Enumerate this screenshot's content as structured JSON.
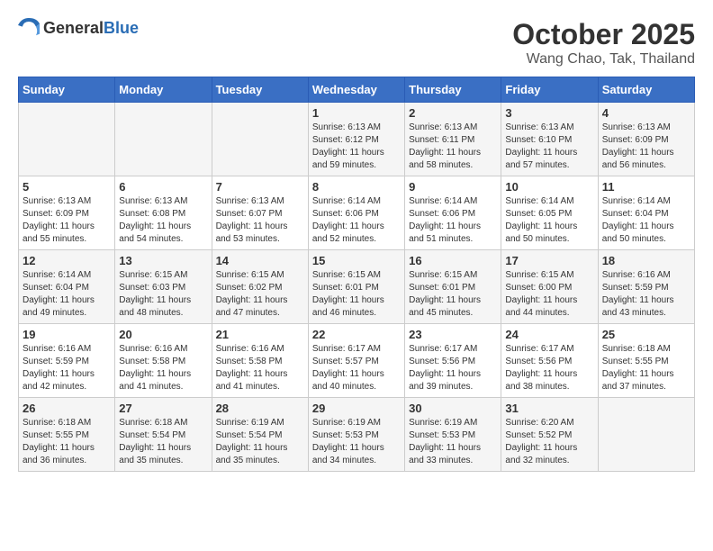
{
  "header": {
    "logo_general": "General",
    "logo_blue": "Blue",
    "month": "October 2025",
    "location": "Wang Chao, Tak, Thailand"
  },
  "calendar": {
    "weekdays": [
      "Sunday",
      "Monday",
      "Tuesday",
      "Wednesday",
      "Thursday",
      "Friday",
      "Saturday"
    ],
    "weeks": [
      [
        {
          "day": "",
          "sunrise": "",
          "sunset": "",
          "daylight": ""
        },
        {
          "day": "",
          "sunrise": "",
          "sunset": "",
          "daylight": ""
        },
        {
          "day": "",
          "sunrise": "",
          "sunset": "",
          "daylight": ""
        },
        {
          "day": "1",
          "sunrise": "Sunrise: 6:13 AM",
          "sunset": "Sunset: 6:12 PM",
          "daylight": "Daylight: 11 hours and 59 minutes."
        },
        {
          "day": "2",
          "sunrise": "Sunrise: 6:13 AM",
          "sunset": "Sunset: 6:11 PM",
          "daylight": "Daylight: 11 hours and 58 minutes."
        },
        {
          "day": "3",
          "sunrise": "Sunrise: 6:13 AM",
          "sunset": "Sunset: 6:10 PM",
          "daylight": "Daylight: 11 hours and 57 minutes."
        },
        {
          "day": "4",
          "sunrise": "Sunrise: 6:13 AM",
          "sunset": "Sunset: 6:09 PM",
          "daylight": "Daylight: 11 hours and 56 minutes."
        }
      ],
      [
        {
          "day": "5",
          "sunrise": "Sunrise: 6:13 AM",
          "sunset": "Sunset: 6:09 PM",
          "daylight": "Daylight: 11 hours and 55 minutes."
        },
        {
          "day": "6",
          "sunrise": "Sunrise: 6:13 AM",
          "sunset": "Sunset: 6:08 PM",
          "daylight": "Daylight: 11 hours and 54 minutes."
        },
        {
          "day": "7",
          "sunrise": "Sunrise: 6:13 AM",
          "sunset": "Sunset: 6:07 PM",
          "daylight": "Daylight: 11 hours and 53 minutes."
        },
        {
          "day": "8",
          "sunrise": "Sunrise: 6:14 AM",
          "sunset": "Sunset: 6:06 PM",
          "daylight": "Daylight: 11 hours and 52 minutes."
        },
        {
          "day": "9",
          "sunrise": "Sunrise: 6:14 AM",
          "sunset": "Sunset: 6:06 PM",
          "daylight": "Daylight: 11 hours and 51 minutes."
        },
        {
          "day": "10",
          "sunrise": "Sunrise: 6:14 AM",
          "sunset": "Sunset: 6:05 PM",
          "daylight": "Daylight: 11 hours and 50 minutes."
        },
        {
          "day": "11",
          "sunrise": "Sunrise: 6:14 AM",
          "sunset": "Sunset: 6:04 PM",
          "daylight": "Daylight: 11 hours and 50 minutes."
        }
      ],
      [
        {
          "day": "12",
          "sunrise": "Sunrise: 6:14 AM",
          "sunset": "Sunset: 6:04 PM",
          "daylight": "Daylight: 11 hours and 49 minutes."
        },
        {
          "day": "13",
          "sunrise": "Sunrise: 6:15 AM",
          "sunset": "Sunset: 6:03 PM",
          "daylight": "Daylight: 11 hours and 48 minutes."
        },
        {
          "day": "14",
          "sunrise": "Sunrise: 6:15 AM",
          "sunset": "Sunset: 6:02 PM",
          "daylight": "Daylight: 11 hours and 47 minutes."
        },
        {
          "day": "15",
          "sunrise": "Sunrise: 6:15 AM",
          "sunset": "Sunset: 6:01 PM",
          "daylight": "Daylight: 11 hours and 46 minutes."
        },
        {
          "day": "16",
          "sunrise": "Sunrise: 6:15 AM",
          "sunset": "Sunset: 6:01 PM",
          "daylight": "Daylight: 11 hours and 45 minutes."
        },
        {
          "day": "17",
          "sunrise": "Sunrise: 6:15 AM",
          "sunset": "Sunset: 6:00 PM",
          "daylight": "Daylight: 11 hours and 44 minutes."
        },
        {
          "day": "18",
          "sunrise": "Sunrise: 6:16 AM",
          "sunset": "Sunset: 5:59 PM",
          "daylight": "Daylight: 11 hours and 43 minutes."
        }
      ],
      [
        {
          "day": "19",
          "sunrise": "Sunrise: 6:16 AM",
          "sunset": "Sunset: 5:59 PM",
          "daylight": "Daylight: 11 hours and 42 minutes."
        },
        {
          "day": "20",
          "sunrise": "Sunrise: 6:16 AM",
          "sunset": "Sunset: 5:58 PM",
          "daylight": "Daylight: 11 hours and 41 minutes."
        },
        {
          "day": "21",
          "sunrise": "Sunrise: 6:16 AM",
          "sunset": "Sunset: 5:58 PM",
          "daylight": "Daylight: 11 hours and 41 minutes."
        },
        {
          "day": "22",
          "sunrise": "Sunrise: 6:17 AM",
          "sunset": "Sunset: 5:57 PM",
          "daylight": "Daylight: 11 hours and 40 minutes."
        },
        {
          "day": "23",
          "sunrise": "Sunrise: 6:17 AM",
          "sunset": "Sunset: 5:56 PM",
          "daylight": "Daylight: 11 hours and 39 minutes."
        },
        {
          "day": "24",
          "sunrise": "Sunrise: 6:17 AM",
          "sunset": "Sunset: 5:56 PM",
          "daylight": "Daylight: 11 hours and 38 minutes."
        },
        {
          "day": "25",
          "sunrise": "Sunrise: 6:18 AM",
          "sunset": "Sunset: 5:55 PM",
          "daylight": "Daylight: 11 hours and 37 minutes."
        }
      ],
      [
        {
          "day": "26",
          "sunrise": "Sunrise: 6:18 AM",
          "sunset": "Sunset: 5:55 PM",
          "daylight": "Daylight: 11 hours and 36 minutes."
        },
        {
          "day": "27",
          "sunrise": "Sunrise: 6:18 AM",
          "sunset": "Sunset: 5:54 PM",
          "daylight": "Daylight: 11 hours and 35 minutes."
        },
        {
          "day": "28",
          "sunrise": "Sunrise: 6:19 AM",
          "sunset": "Sunset: 5:54 PM",
          "daylight": "Daylight: 11 hours and 35 minutes."
        },
        {
          "day": "29",
          "sunrise": "Sunrise: 6:19 AM",
          "sunset": "Sunset: 5:53 PM",
          "daylight": "Daylight: 11 hours and 34 minutes."
        },
        {
          "day": "30",
          "sunrise": "Sunrise: 6:19 AM",
          "sunset": "Sunset: 5:53 PM",
          "daylight": "Daylight: 11 hours and 33 minutes."
        },
        {
          "day": "31",
          "sunrise": "Sunrise: 6:20 AM",
          "sunset": "Sunset: 5:52 PM",
          "daylight": "Daylight: 11 hours and 32 minutes."
        },
        {
          "day": "",
          "sunrise": "",
          "sunset": "",
          "daylight": ""
        }
      ]
    ]
  }
}
